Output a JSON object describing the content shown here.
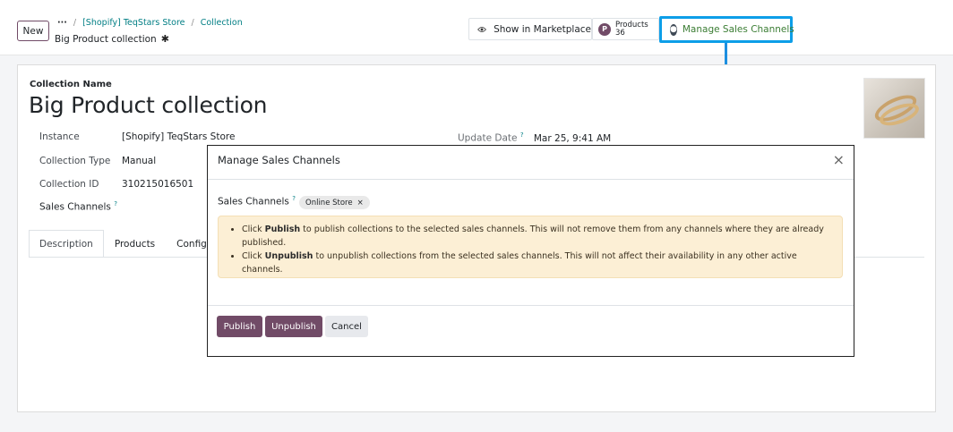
{
  "topbar": {
    "new_label": "New",
    "crumb_dots": "···",
    "crumbs": [
      "[Shopify] TeqStars Store",
      "Collection"
    ],
    "record_title": "Big Product collection"
  },
  "smart_buttons": {
    "marketplace_label": "Show in Marketplace",
    "products_icon": "P",
    "products_label": "Products",
    "products_count": "36",
    "channels_label": "Manage Sales Channels"
  },
  "form": {
    "name_label": "Collection Name",
    "name": "Big Product collection",
    "fields": [
      {
        "label": "Instance",
        "value": "[Shopify] TeqStars Store"
      },
      {
        "label": "Collection Type",
        "value": "Manual"
      },
      {
        "label": "Collection ID",
        "value": "310215016501"
      },
      {
        "label": "Sales Channels",
        "value": ""
      }
    ],
    "update_label": "Update Date",
    "update_value": "Mar 25, 9:41 AM",
    "help_mark": "?",
    "tabs": [
      "Description",
      "Products",
      "Configur"
    ]
  },
  "modal": {
    "title": "Manage Sales Channels",
    "close": "×",
    "sales_channels_label": "Sales Channels",
    "tag": "Online Store",
    "tag_remove": "×",
    "info": {
      "line1_prefix": "Click ",
      "line1_bold": "Publish",
      "line1_rest": " to publish collections to the selected sales channels. This will not remove them from any channels where they are already published.",
      "line2_prefix": "Click ",
      "line2_bold": "Unpublish",
      "line2_rest": " to unpublish collections from the selected sales channels. This will not affect their availability in any other active channels."
    },
    "buttons": {
      "publish": "Publish",
      "unpublish": "Unpublish",
      "cancel": "Cancel"
    }
  },
  "colors": {
    "primary": "#714b67",
    "highlight": "#0d9ee8",
    "link": "#017e84",
    "info_bg": "#fcefd5"
  }
}
